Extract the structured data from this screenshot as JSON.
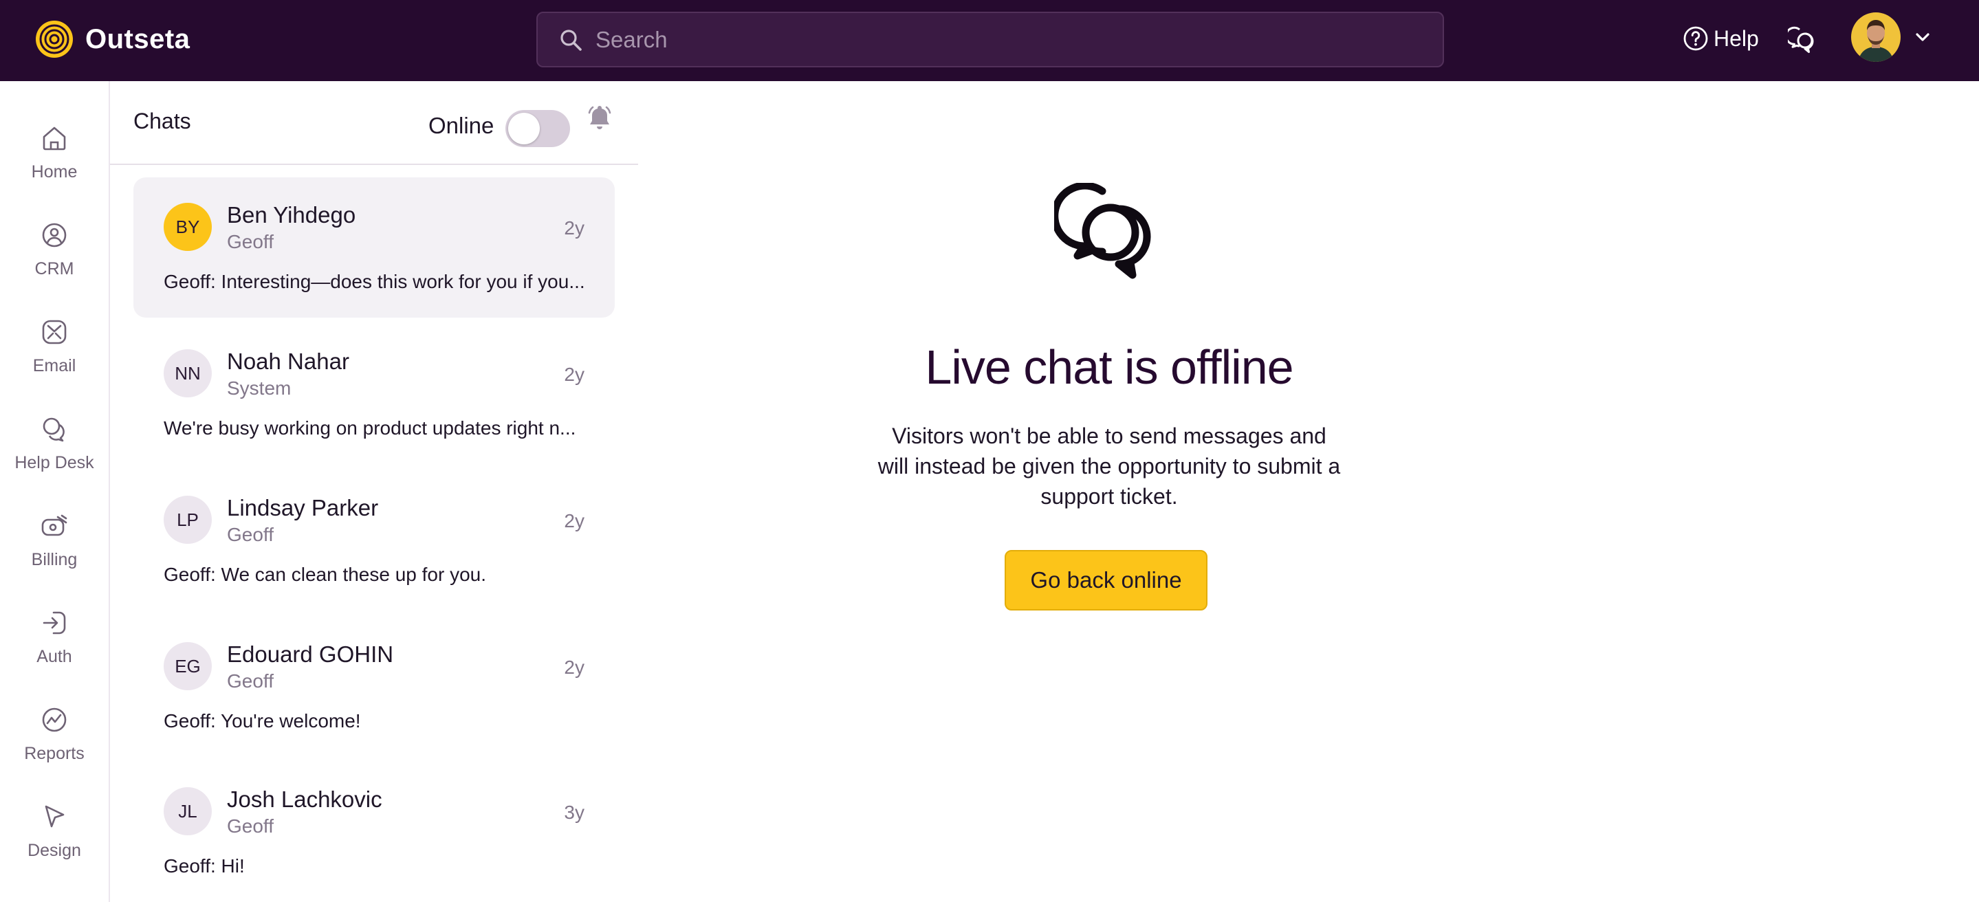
{
  "app": {
    "name": "Outseta",
    "logo_icon": "outseta-logo-icon",
    "brand_color": "#260a2f",
    "accent_color": "#fcc419"
  },
  "header": {
    "search_placeholder": "Search",
    "help_label": "Help",
    "chat_icon": "chat-bubbles-icon",
    "avatar_icon": "user-avatar",
    "menu_icon": "chevron-down-icon"
  },
  "nav": {
    "items": [
      {
        "label": "Home",
        "icon": "home-icon"
      },
      {
        "label": "CRM",
        "icon": "crm-icon"
      },
      {
        "label": "Email",
        "icon": "email-icon"
      },
      {
        "label": "Help Desk",
        "icon": "help-desk-icon"
      },
      {
        "label": "Billing",
        "icon": "billing-icon"
      },
      {
        "label": "Auth",
        "icon": "auth-icon"
      },
      {
        "label": "Reports",
        "icon": "reports-icon"
      },
      {
        "label": "Design",
        "icon": "design-icon"
      }
    ]
  },
  "chats": {
    "title": "Chats",
    "online_label": "Online",
    "online_enabled": false,
    "bell_icon": "bell-icon",
    "items": [
      {
        "initials": "BY",
        "name": "Ben Yihdego",
        "sub": "Geoff",
        "time": "2y",
        "preview": "Geoff: Interesting—does this work for you if you...",
        "active": true
      },
      {
        "initials": "NN",
        "name": "Noah Nahar",
        "sub": "System",
        "time": "2y",
        "preview": "We're busy working on product updates right n...",
        "active": false
      },
      {
        "initials": "LP",
        "name": "Lindsay Parker",
        "sub": "Geoff",
        "time": "2y",
        "preview": "Geoff: We can clean these up for you.",
        "active": false
      },
      {
        "initials": "EG",
        "name": "Edouard GOHIN",
        "sub": "Geoff",
        "time": "2y",
        "preview": "Geoff: You're welcome!",
        "active": false
      },
      {
        "initials": "JL",
        "name": "Josh Lachkovic",
        "sub": "Geoff",
        "time": "3y",
        "preview": "Geoff: Hi!",
        "active": false
      }
    ]
  },
  "main": {
    "icon": "chat-bubbles-icon",
    "title": "Live chat is offline",
    "description": "Visitors won't be able to send messages and will instead be given the opportunity to submit a support ticket.",
    "button_label": "Go back online"
  }
}
